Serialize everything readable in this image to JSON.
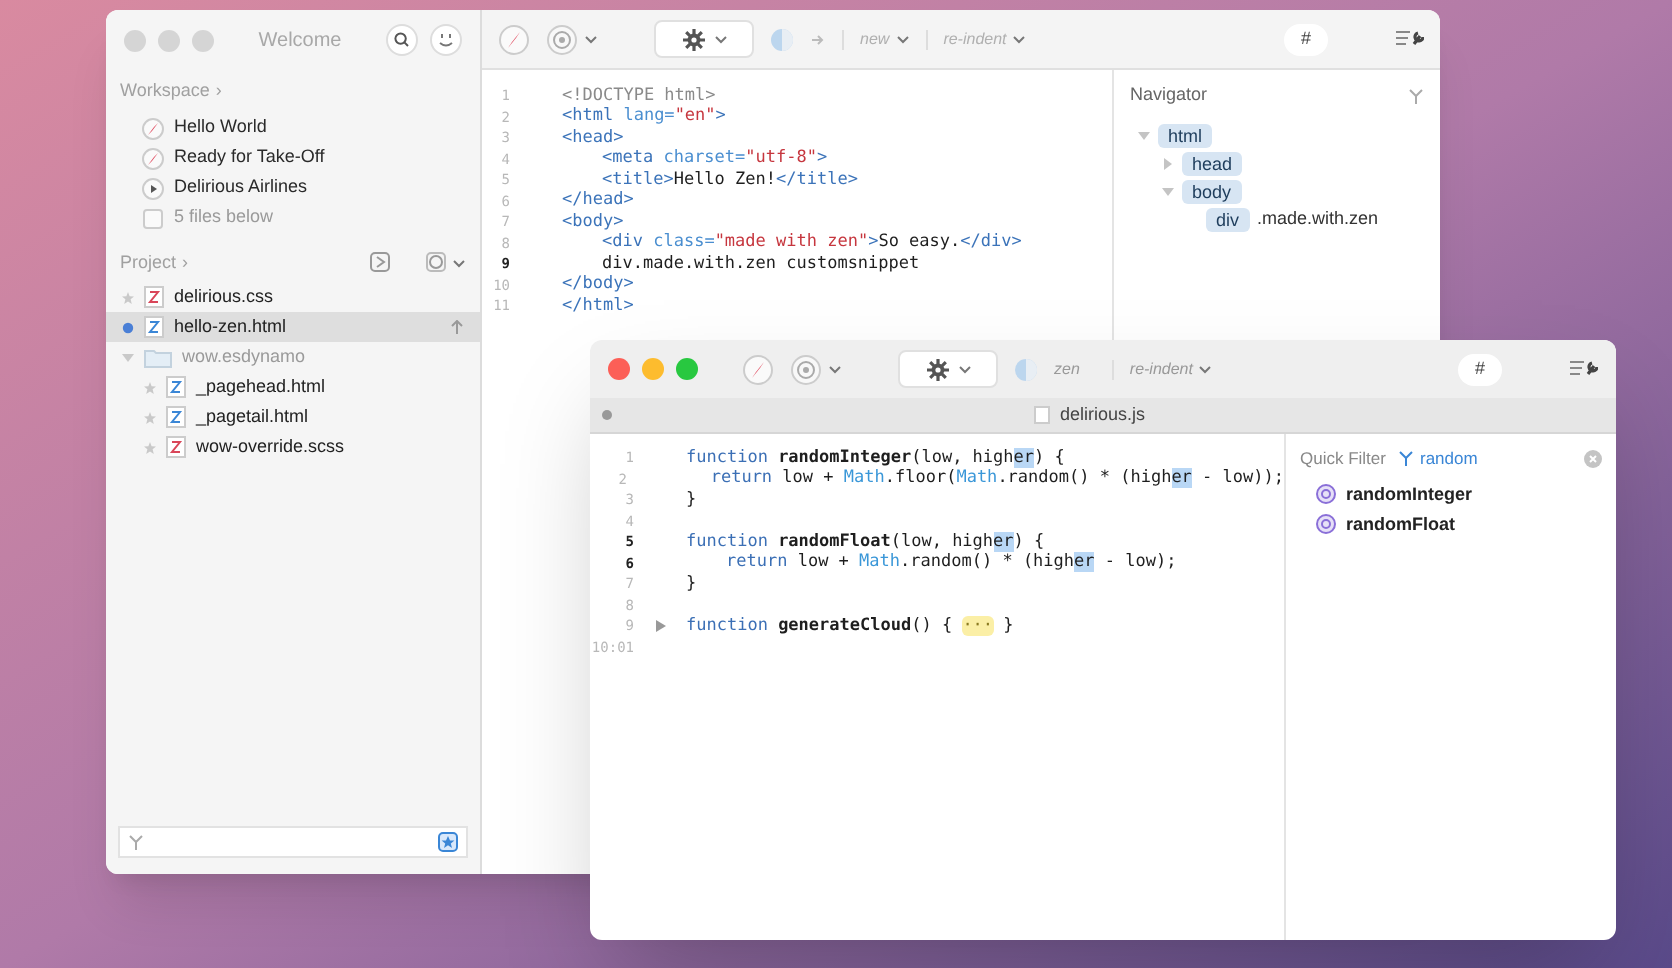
{
  "welcome_window": {
    "title": "Welcome",
    "active": false,
    "workspace": {
      "heading": "Workspace",
      "chevron": "›",
      "items": [
        {
          "kind": "project",
          "label": "Hello World"
        },
        {
          "kind": "project",
          "label": "Ready for Take-Off"
        },
        {
          "kind": "play",
          "label": "Delirious Airlines"
        },
        {
          "kind": "summary",
          "label": "5 files below"
        }
      ]
    },
    "project": {
      "heading": "Project",
      "chevron": "›",
      "files": [
        {
          "kind": "css",
          "label": "delirious.css",
          "selected": false
        },
        {
          "kind": "html",
          "label": "hello-zen.html",
          "selected": true
        },
        {
          "kind": "folder",
          "label": "wow.esdynamo",
          "selected": false,
          "expanded": true,
          "children": [
            {
              "kind": "html",
              "label": "_pagehead.html",
              "selected": false
            },
            {
              "kind": "html",
              "label": "_pagetail.html",
              "selected": false
            },
            {
              "kind": "css",
              "label": "wow-override.scss",
              "selected": false
            }
          ]
        }
      ]
    },
    "toolbar": {
      "actions": [
        "new",
        "re-indent"
      ],
      "hash_button": "#"
    },
    "code": [
      {
        "number": "1",
        "current": false,
        "indented": false,
        "tokens": [
          {
            "kind": "doctype",
            "text": "<!DOCTYPE html>"
          }
        ]
      },
      {
        "number": "2",
        "current": false,
        "indented": false,
        "tokens": [
          {
            "kind": "tag",
            "text": "<html"
          },
          {
            "kind": "attr",
            "text": " lang="
          },
          {
            "kind": "string",
            "text": "\"en\""
          },
          {
            "kind": "tag",
            "text": ">"
          }
        ]
      },
      {
        "number": "3",
        "current": false,
        "indented": false,
        "tokens": [
          {
            "kind": "tag",
            "text": "<head>"
          }
        ]
      },
      {
        "number": "4",
        "current": false,
        "indented": true,
        "tokens": [
          {
            "kind": "tag",
            "text": "<meta"
          },
          {
            "kind": "attr",
            "text": " charset="
          },
          {
            "kind": "string",
            "text": "\"utf-8\""
          },
          {
            "kind": "tag",
            "text": ">"
          }
        ]
      },
      {
        "number": "5",
        "current": false,
        "indented": true,
        "tokens": [
          {
            "kind": "tag",
            "text": "<title>"
          },
          {
            "kind": "text",
            "text": "Hello Zen!"
          },
          {
            "kind": "tag",
            "text": "</title>"
          }
        ]
      },
      {
        "number": "6",
        "current": false,
        "indented": false,
        "tokens": [
          {
            "kind": "tag",
            "text": "</head>"
          }
        ]
      },
      {
        "number": "7",
        "current": false,
        "indented": false,
        "tokens": [
          {
            "kind": "tag",
            "text": "<body>"
          }
        ]
      },
      {
        "number": "8",
        "current": false,
        "indented": true,
        "tokens": [
          {
            "kind": "tag",
            "text": "<div"
          },
          {
            "kind": "attr",
            "text": " class="
          },
          {
            "kind": "string",
            "text": "\"made with zen\""
          },
          {
            "kind": "tag",
            "text": ">"
          },
          {
            "kind": "text",
            "text": "So easy."
          },
          {
            "kind": "tag",
            "text": "</div>"
          }
        ]
      },
      {
        "number": "9",
        "current": true,
        "indented": true,
        "tokens": [
          {
            "kind": "text",
            "text": "div.made.with.zen customsnippet"
          }
        ]
      },
      {
        "number": "10",
        "current": false,
        "indented": false,
        "tokens": [
          {
            "kind": "tag",
            "text": "</body>"
          }
        ]
      },
      {
        "number": "11",
        "current": false,
        "indented": false,
        "tokens": [
          {
            "kind": "tag",
            "text": "</html>"
          }
        ]
      }
    ],
    "navigator": {
      "title": "Navigator",
      "tree": [
        {
          "tag": "html",
          "expanded": true,
          "children": [
            {
              "tag": "head",
              "expanded": false
            },
            {
              "tag": "body",
              "expanded": true,
              "children": [
                {
                  "tag": "div",
                  "detail": ".made.with.zen"
                }
              ]
            }
          ]
        }
      ]
    }
  },
  "editor_window": {
    "active": true,
    "toolbar": {
      "mode": "zen",
      "action": "re-indent",
      "hash_button": "#"
    },
    "tab": {
      "title": "delirious.js"
    },
    "code": [
      {
        "number": "1",
        "current": false,
        "fold": false,
        "indented": false,
        "tokens": [
          {
            "kind": "keyword",
            "text": "function "
          },
          {
            "kind": "fn",
            "text": "randomInteger"
          },
          {
            "kind": "text",
            "text": "(low, high"
          },
          {
            "kind": "match",
            "text": "er"
          },
          {
            "kind": "text",
            "text": ") {"
          }
        ]
      },
      {
        "number": "2",
        "current": false,
        "fold": false,
        "indented": true,
        "tokens": [
          {
            "kind": "keyword",
            "text": "return"
          },
          {
            "kind": "text",
            "text": " low + "
          },
          {
            "kind": "builtin",
            "text": "Math"
          },
          {
            "kind": "text",
            "text": ".floor("
          },
          {
            "kind": "builtin",
            "text": "Math"
          },
          {
            "kind": "text",
            "text": ".random() * (high"
          },
          {
            "kind": "match",
            "text": "er"
          },
          {
            "kind": "text",
            "text": " - low));"
          }
        ]
      },
      {
        "number": "3",
        "current": false,
        "fold": false,
        "indented": false,
        "tokens": [
          {
            "kind": "text",
            "text": "}"
          }
        ]
      },
      {
        "number": "4",
        "current": false,
        "fold": false
      },
      {
        "number": "5",
        "current": true,
        "fold": false,
        "indented": false,
        "tokens": [
          {
            "kind": "keyword",
            "text": "function "
          },
          {
            "kind": "fn",
            "text": "randomFloat"
          },
          {
            "kind": "text",
            "text": "(low, high"
          },
          {
            "kind": "match",
            "text": "er"
          },
          {
            "kind": "text",
            "text": ") {"
          }
        ]
      },
      {
        "number": "6",
        "current": true,
        "fold": false,
        "indented": true,
        "tokens": [
          {
            "kind": "keyword",
            "text": "return"
          },
          {
            "kind": "text",
            "text": " low + "
          },
          {
            "kind": "builtin",
            "text": "Math"
          },
          {
            "kind": "text",
            "text": ".random() * (high"
          },
          {
            "kind": "match",
            "text": "er"
          },
          {
            "kind": "text",
            "text": " - low);"
          }
        ]
      },
      {
        "number": "7",
        "current": false,
        "fold": false,
        "indented": false,
        "tokens": [
          {
            "kind": "text",
            "text": "}"
          }
        ]
      },
      {
        "number": "8",
        "current": false,
        "fold": false
      },
      {
        "number": "9",
        "current": false,
        "fold": true,
        "indented": false,
        "tokens": [
          {
            "kind": "keyword",
            "text": "function "
          },
          {
            "kind": "fn",
            "text": "generateCloud"
          },
          {
            "kind": "text",
            "text": "() { "
          },
          {
            "kind": "collapsed",
            "text": "···"
          },
          {
            "kind": "text",
            "text": " }"
          }
        ]
      },
      {
        "number": "10:01",
        "current": false,
        "fold": false
      }
    ],
    "quick_filter": {
      "label": "Quick Filter",
      "query": "random",
      "results": [
        "randomInteger",
        "randomFloat"
      ]
    }
  }
}
